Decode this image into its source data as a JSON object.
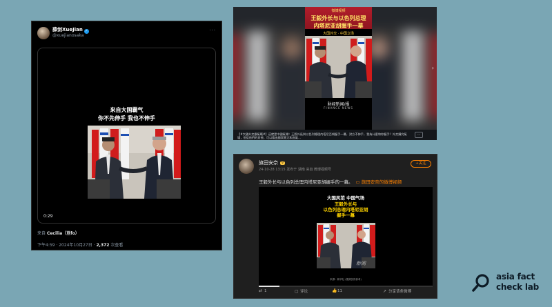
{
  "twitter": {
    "display_name": "薛剑XueJian",
    "handle": "@xuejianosaka",
    "video_caption_line1": "来自大国霸气",
    "video_caption_line2": "你不先伸手 我也不伸手",
    "video_time": "0:29",
    "from_label": "来自",
    "from_user": "Cecilia（亘fo）",
    "timestamp": "下午4:59 · 2024年10月27日 ·",
    "views": "2,372",
    "views_label": "次查看"
  },
  "video_post": {
    "tag": "微博视频",
    "title_line1": "王毅外长与以色列总理",
    "title_line2": "内塔尼亚胡握手一幕",
    "title_line3": "大国外交 · 中国立场",
    "watermark_cn": "財经新闻/报",
    "watermark_en": "FINANCE NEWS",
    "description": "【#大國外交霸氣範#】這就是中國氣場！王毅外長與以色列總理內塔尼亞胡握手一幕，對方不伸手，我為什麼和你握手？外交講究氣場，但從他們的對視，可以看出國家實力和底氣…",
    "more_label": "…"
  },
  "weibo": {
    "username": "旗田安奈",
    "badge": "V",
    "meta": "24-10-28 13:15 发布于 湖南 来自 微博视频号",
    "follow_label": "+关注",
    "text": "王毅外长与以色列总理内塔尼亚胡握手的一幕。",
    "link_label": "旗田安奈的微博视频",
    "video_line1": "大国风范 中国气场",
    "video_line2": "王毅外长与",
    "video_line3": "以色列总理内塔尼亚胡",
    "video_line4": "握手一幕",
    "video_watermark": "新闻",
    "video_subcaption": "来源：新华社 (视频仅供参考)",
    "progress": 0.12,
    "repost_count": "1",
    "comment_label": "评论",
    "like_count": "11",
    "share_label": "分享该条微博"
  },
  "logo": {
    "line1": "asia fact",
    "line2": "check lab"
  }
}
